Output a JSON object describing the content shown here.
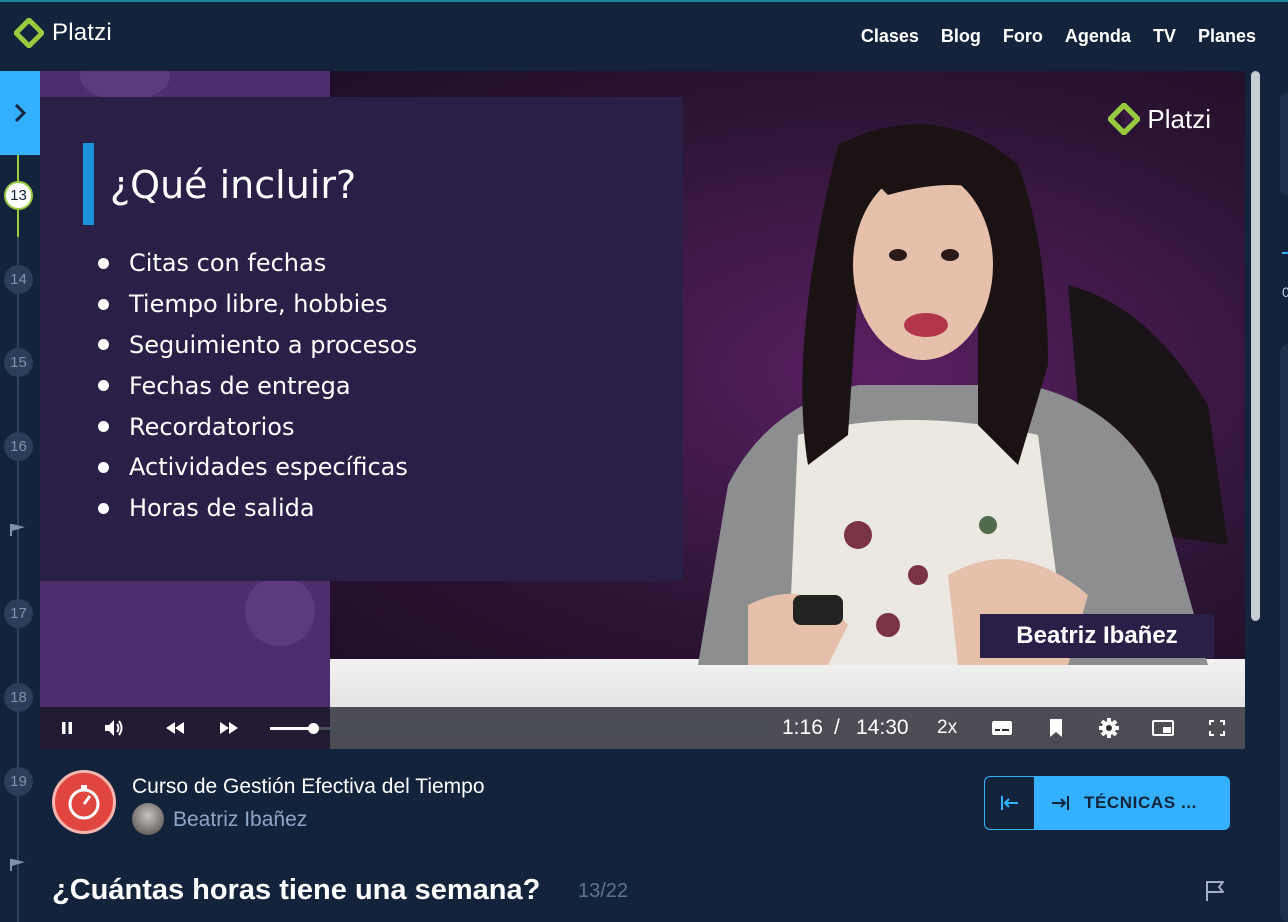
{
  "brand": {
    "name": "Platzi",
    "accent": "#98ca3f",
    "primary": "#33b1ff"
  },
  "nav": {
    "items": [
      "Clases",
      "Blog",
      "Foro",
      "Agenda",
      "TV",
      "Planes"
    ]
  },
  "rail": {
    "lessons": [
      "13",
      "14",
      "15",
      "16",
      "17",
      "18",
      "19"
    ],
    "current": "13"
  },
  "video": {
    "slide": {
      "title": "¿Qué incluir?",
      "bullets": [
        "Citas con fechas",
        "Tiempo libre, hobbies",
        "Seguimiento a procesos",
        "Fechas de entrega",
        "Recordatorios",
        "Actividades específicas",
        "Horas de salida"
      ]
    },
    "watermark": "Platzi",
    "lower_third": "Beatriz Ibañez",
    "controls": {
      "current_time": "1:16",
      "separator": "/",
      "duration": "14:30",
      "speed": "2x",
      "progress": 0.088
    }
  },
  "course": {
    "title": "Curso de Gestión Efectiva del Tiempo",
    "teacher": "Beatriz Ibañez"
  },
  "next_lesson": {
    "label": "TÉCNICAS ..."
  },
  "lesson": {
    "title": "¿Cuántas horas tiene una semana?",
    "count": "13/22"
  },
  "right_panel": {
    "visible_char": "0"
  },
  "icons": {
    "rail_toggle": "chevron-right-icon",
    "play_pause": "pause-icon",
    "volume": "volume-icon",
    "rewind": "rewind-icon",
    "forward": "fast-forward-icon",
    "subtitles": "subtitles-icon",
    "bookmark": "bookmark-icon",
    "settings": "gear-icon",
    "pip": "picture-in-picture-icon",
    "fullscreen": "fullscreen-icon",
    "report": "flag-icon"
  }
}
